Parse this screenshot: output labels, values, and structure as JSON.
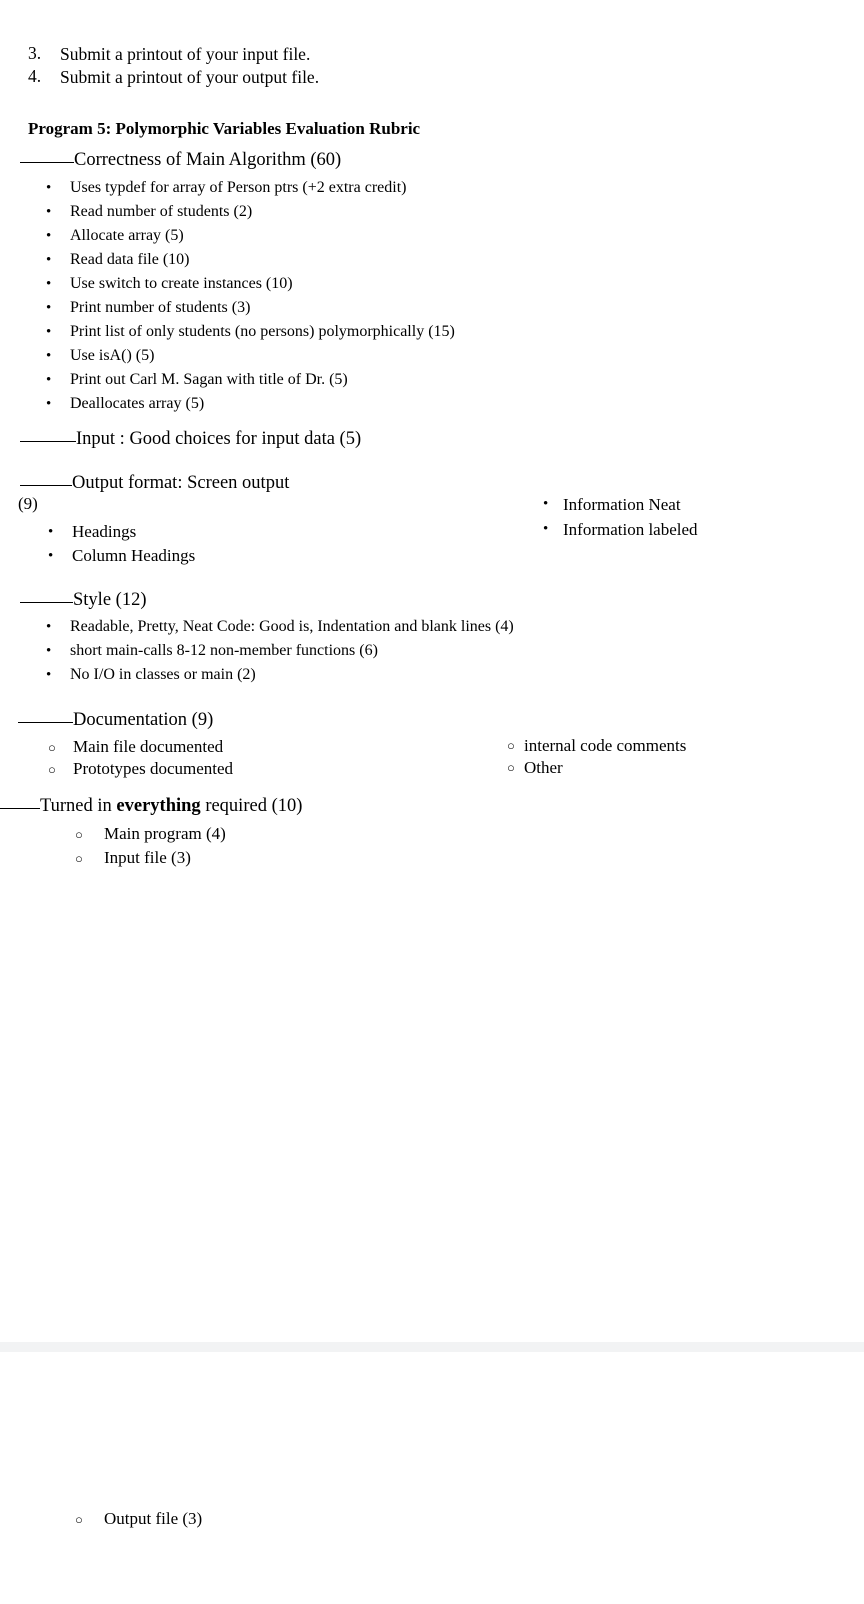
{
  "document": {
    "numbered_items": [
      {
        "marker": "3.",
        "text": "Submit a printout of your input file."
      },
      {
        "marker": "4.",
        "text": "Submit a printout of your output file."
      }
    ],
    "title": "Program 5: Polymorphic Variables Evaluation Rubric",
    "sections": {
      "correctness": {
        "heading": "Correctness of Main Algorithm  (60)",
        "bullets": [
          "Uses typdef for array of Person ptrs (+2 extra credit)",
          "Read number of students (2)",
          "Allocate array (5)",
          "Read data file (10)",
          "Use switch to create instances (10)",
          "Print number of students (3)",
          "Print list of only students (no persons) polymorphically (15)",
          "Use isA()  (5)",
          "Print out Carl M. Sagan with title of Dr.  (5)",
          "Deallocates array (5)"
        ]
      },
      "input": {
        "heading": "Input : Good choices for input data (5)"
      },
      "output_format": {
        "heading": "Output format:  Screen output",
        "score": "(9)",
        "left_bullets": [
          "Headings",
          "Column Headings"
        ],
        "right_bullets": [
          "Information Neat",
          "Information labeled"
        ]
      },
      "style": {
        "heading": "Style (12)",
        "bullets": [
          "Readable, Pretty, Neat Code: Good is, Indentation and blank lines (4)",
          "short main-calls 8-12 non-member functions (6)",
          "No I/O in classes or main (2)"
        ]
      },
      "documentation": {
        "heading": "Documentation (9)",
        "left_bullets": [
          "Main file documented",
          "Prototypes documented"
        ],
        "right_bullets": [
          "internal code comments",
          "Other"
        ]
      },
      "turned_in": {
        "heading_before": "Turned in ",
        "heading_bold": "everything",
        "heading_after": " required (10)",
        "bullets_page_one": [
          "Main program (4)",
          "Input file (3)"
        ],
        "bullets_page_two": [
          "Output file (3)"
        ]
      }
    }
  }
}
